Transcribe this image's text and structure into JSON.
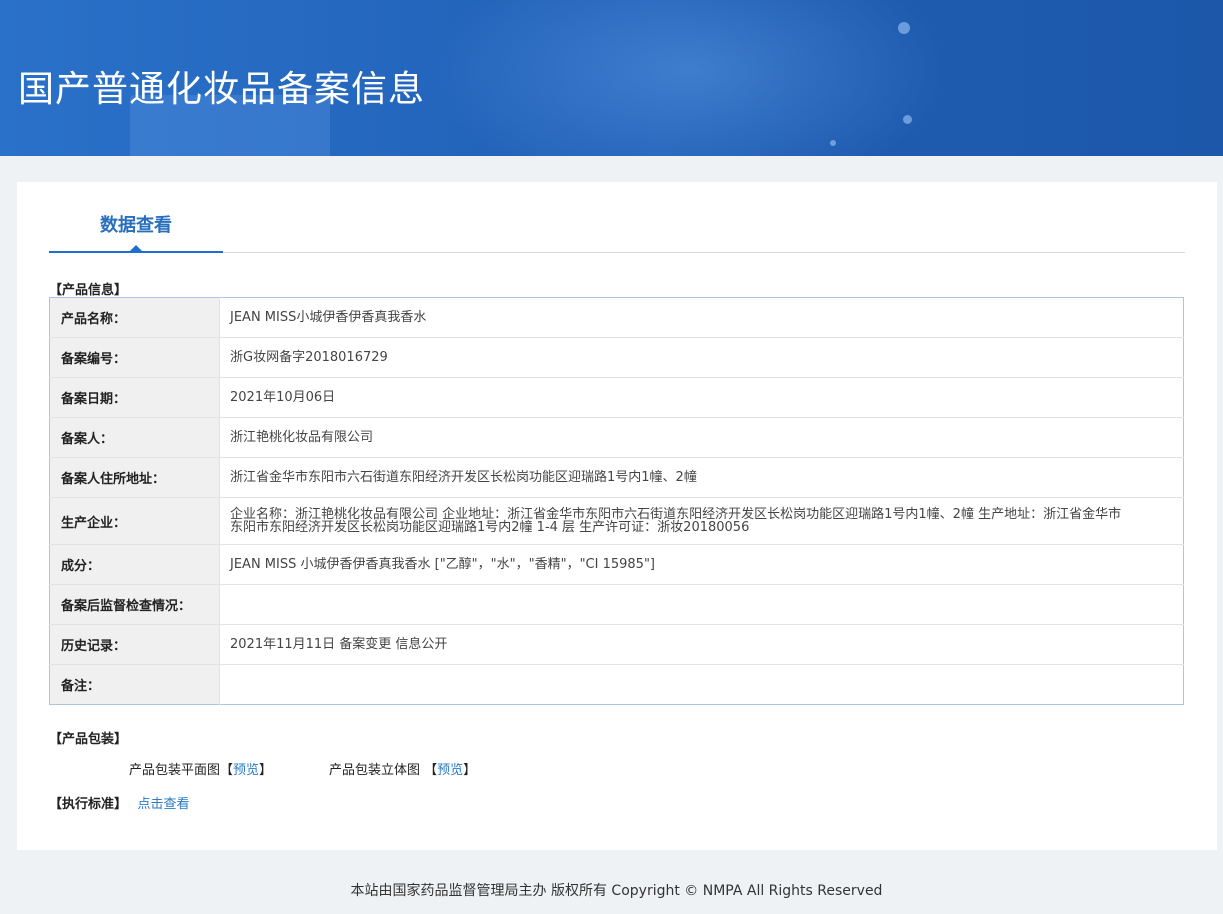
{
  "header": {
    "title": "国产普通化妆品备案信息"
  },
  "tabs": [
    {
      "label": "数据查看"
    }
  ],
  "product_info": {
    "section_label": "【产品信息】",
    "rows": [
      {
        "label": "产品名称：",
        "value": "JEAN MISS小城伊香伊香真我香水"
      },
      {
        "label": "备案编号：",
        "value": "浙G妆网备字2018016729"
      },
      {
        "label": "备案日期：",
        "value": "2021年10月06日"
      },
      {
        "label": "备案人：",
        "value": "浙江艳桃化妆品有限公司"
      },
      {
        "label": "备案人住所地址：",
        "value": "浙江省金华市东阳市六石街道东阳经济开发区长松岗功能区迎瑞路1号内1幢、2幢"
      },
      {
        "label": "生产企业：",
        "value": "企业名称：浙江艳桃化妆品有限公司 企业地址：浙江省金华市东阳市六石街道东阳经济开发区长松岗功能区迎瑞路1号内1幢、2幢 生产地址：浙江省金华市东阳市东阳经济开发区长松岗功能区迎瑞路1号内2幢 1-4 层 生产许可证：浙妆20180056"
      },
      {
        "label": "成分：",
        "value": "JEAN MISS 小城伊香伊香真我香水 [\"乙醇\"，\"水\"，\"香精\"，\"CI 15985\"]"
      },
      {
        "label": "备案后监督检查情况：",
        "value": ""
      },
      {
        "label": "历史记录：",
        "value": "2021年11月11日 备案变更 信息公开"
      },
      {
        "label": "备注：",
        "value": ""
      }
    ]
  },
  "packaging": {
    "section_label": "【产品包装】",
    "flat_label": "产品包装平面图",
    "flat_bracket_open": "【",
    "flat_link": "预览",
    "flat_bracket_close": "】",
    "solid_label": "产品包装立体图 ",
    "solid_bracket_open": "【",
    "solid_link": "预览",
    "solid_bracket_close": "】"
  },
  "standard": {
    "section_label": "【执行标准】",
    "link": "点击查看"
  },
  "footer": {
    "text": "本站由国家药品监督管理局主办 版权所有 Copyright © NMPA All Rights Reserved"
  }
}
